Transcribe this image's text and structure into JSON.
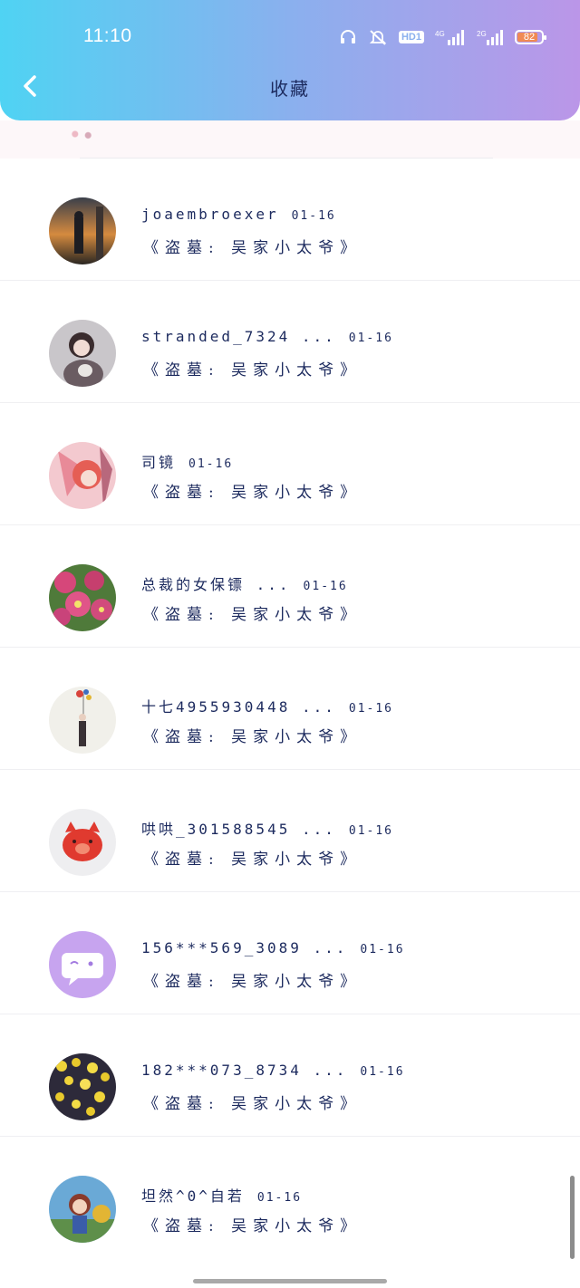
{
  "status_bar": {
    "time": "11:10",
    "hd_label": "HD1",
    "network_1": "4G",
    "network_2": "2G",
    "battery": "82"
  },
  "header": {
    "title": "收藏"
  },
  "items": [
    {
      "username": "joaembroexer",
      "date": "01-16",
      "title": "《盗墓: 吴家小太爷》"
    },
    {
      "username": "stranded_7324 ...",
      "date": "01-16",
      "title": "《盗墓: 吴家小太爷》"
    },
    {
      "username": "司镜",
      "date": "01-16",
      "title": "《盗墓: 吴家小太爷》"
    },
    {
      "username": "总裁的女保镖 ...",
      "date": "01-16",
      "title": "《盗墓: 吴家小太爷》"
    },
    {
      "username": "十七4955930448 ...",
      "date": "01-16",
      "title": "《盗墓: 吴家小太爷》"
    },
    {
      "username": "哄哄_301588545 ...",
      "date": "01-16",
      "title": "《盗墓: 吴家小太爷》"
    },
    {
      "username": "156***569_3089 ...",
      "date": "01-16",
      "title": "《盗墓: 吴家小太爷》"
    },
    {
      "username": "182***073_8734 ...",
      "date": "01-16",
      "title": "《盗墓: 吴家小太爷》"
    },
    {
      "username": "坦然^0^自若",
      "date": "01-16",
      "title": "《盗墓: 吴家小太爷》"
    }
  ]
}
